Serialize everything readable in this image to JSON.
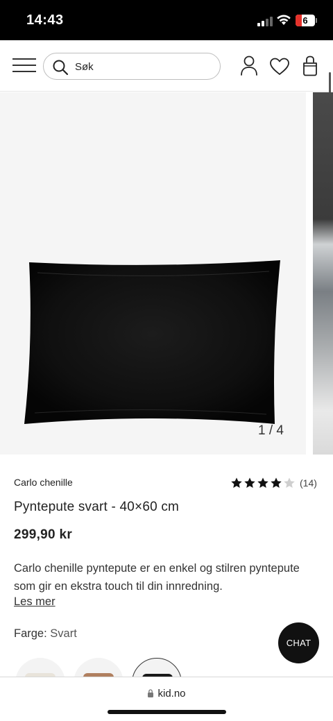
{
  "status_bar": {
    "time": "14:43",
    "battery_level": "6",
    "icons": [
      "signal-icon",
      "wifi-icon",
      "battery-icon"
    ]
  },
  "header": {
    "search_placeholder": "Søk",
    "icons": [
      "menu-icon",
      "search-icon",
      "account-icon",
      "wishlist-heart-icon",
      "shopping-bag-icon"
    ]
  },
  "gallery": {
    "counter": "1 / 4"
  },
  "product": {
    "brand": "Carlo chenille",
    "rating": {
      "value": 4,
      "max": 5,
      "count": "(14)"
    },
    "title": "Pyntepute svart - 40×60 cm",
    "price": "299,90 kr",
    "description": "Carlo chenille pyntepute er en enkel og stilren pyntepute som gir en ekstra touch til din innredning.",
    "read_more": "Les mer",
    "color_label": "Farge:",
    "color_value": "Svart",
    "swatch_colors": [
      "#e8e3da",
      "#b07f5f",
      "#1a1a1a"
    ]
  },
  "chat": {
    "label": "CHAT"
  },
  "browser": {
    "url": "kid.no"
  },
  "colors": {
    "accent": "#111111",
    "star": "#111111",
    "star_empty": "#cfcfcf"
  }
}
